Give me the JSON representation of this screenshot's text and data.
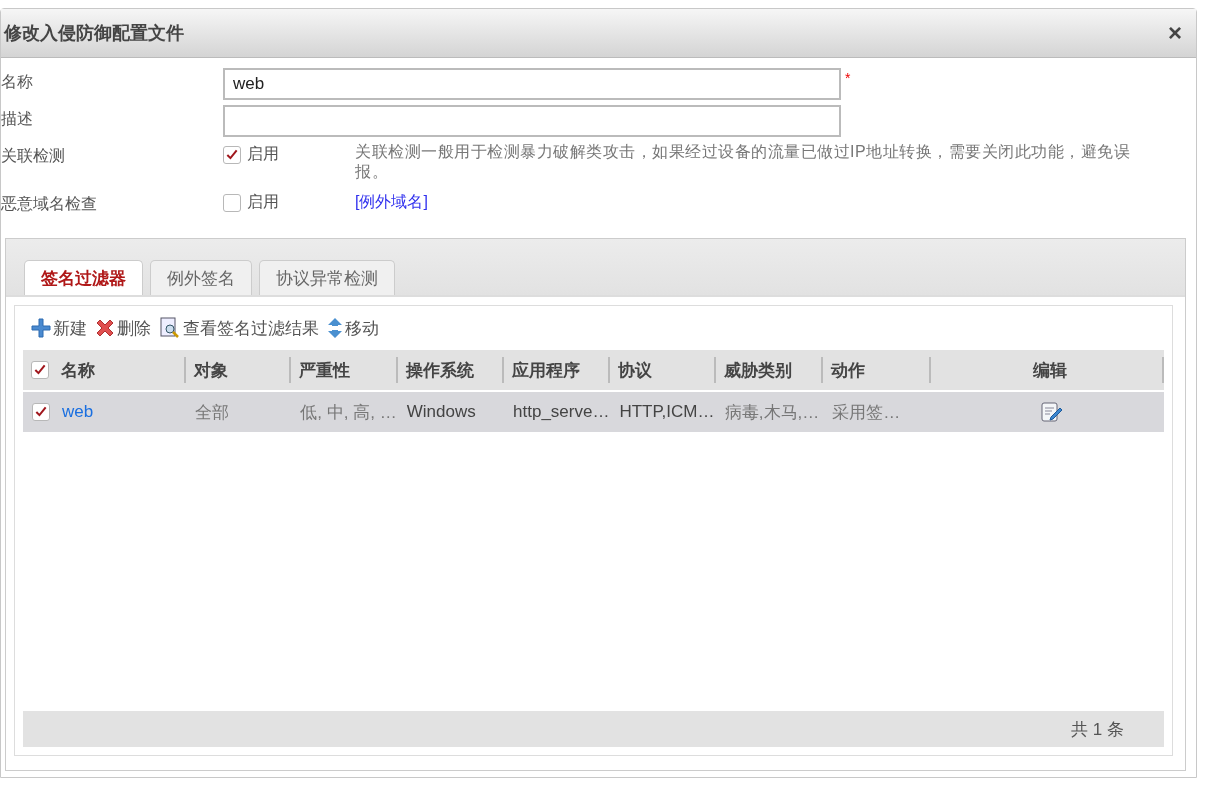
{
  "window": {
    "title": "修改入侵防御配置文件",
    "close": "×"
  },
  "form": [
    {
      "kind": "text",
      "label": "名称",
      "value": "web",
      "required": "*"
    },
    {
      "kind": "text",
      "label": "描述"
    },
    {
      "kind": "checkbox",
      "label": "关联检测",
      "option": "启用",
      "checked": true,
      "note": "关联检测一般用于检测暴力破解类攻击，如果经过设备的流量已做过IP地址转换，需要关闭此功能，避免误报。"
    },
    {
      "kind": "checkbox",
      "label": "恶意域名检查",
      "option": "启用",
      "checked": false,
      "link": "[例外域名]"
    }
  ],
  "tabs": [
    {
      "label": "签名过滤器",
      "selected": true
    },
    {
      "label": "例外签名",
      "selected": false
    },
    {
      "label": "协议异常检测",
      "selected": false
    }
  ],
  "toolbar": [
    {
      "kind": "add",
      "label": "新建"
    },
    {
      "kind": "delete",
      "label": "删除"
    },
    {
      "kind": "view",
      "label": "查看签名过滤结果"
    },
    {
      "kind": "move",
      "label": "移动"
    }
  ],
  "table": {
    "all_checked": true,
    "columns": [
      "名称",
      "对象",
      "严重性",
      "操作系统",
      "应用程序",
      "协议",
      "威胁类别",
      "动作",
      "编辑"
    ],
    "rows": [
      {
        "checked": true,
        "cells": [
          "web",
          "全部",
          "低, 中, 高, …",
          "Windows",
          "http_serve…",
          "HTTP,ICM…",
          "病毒,木马,…",
          "采用签…"
        ]
      }
    ]
  },
  "footer": "共 1 条"
}
